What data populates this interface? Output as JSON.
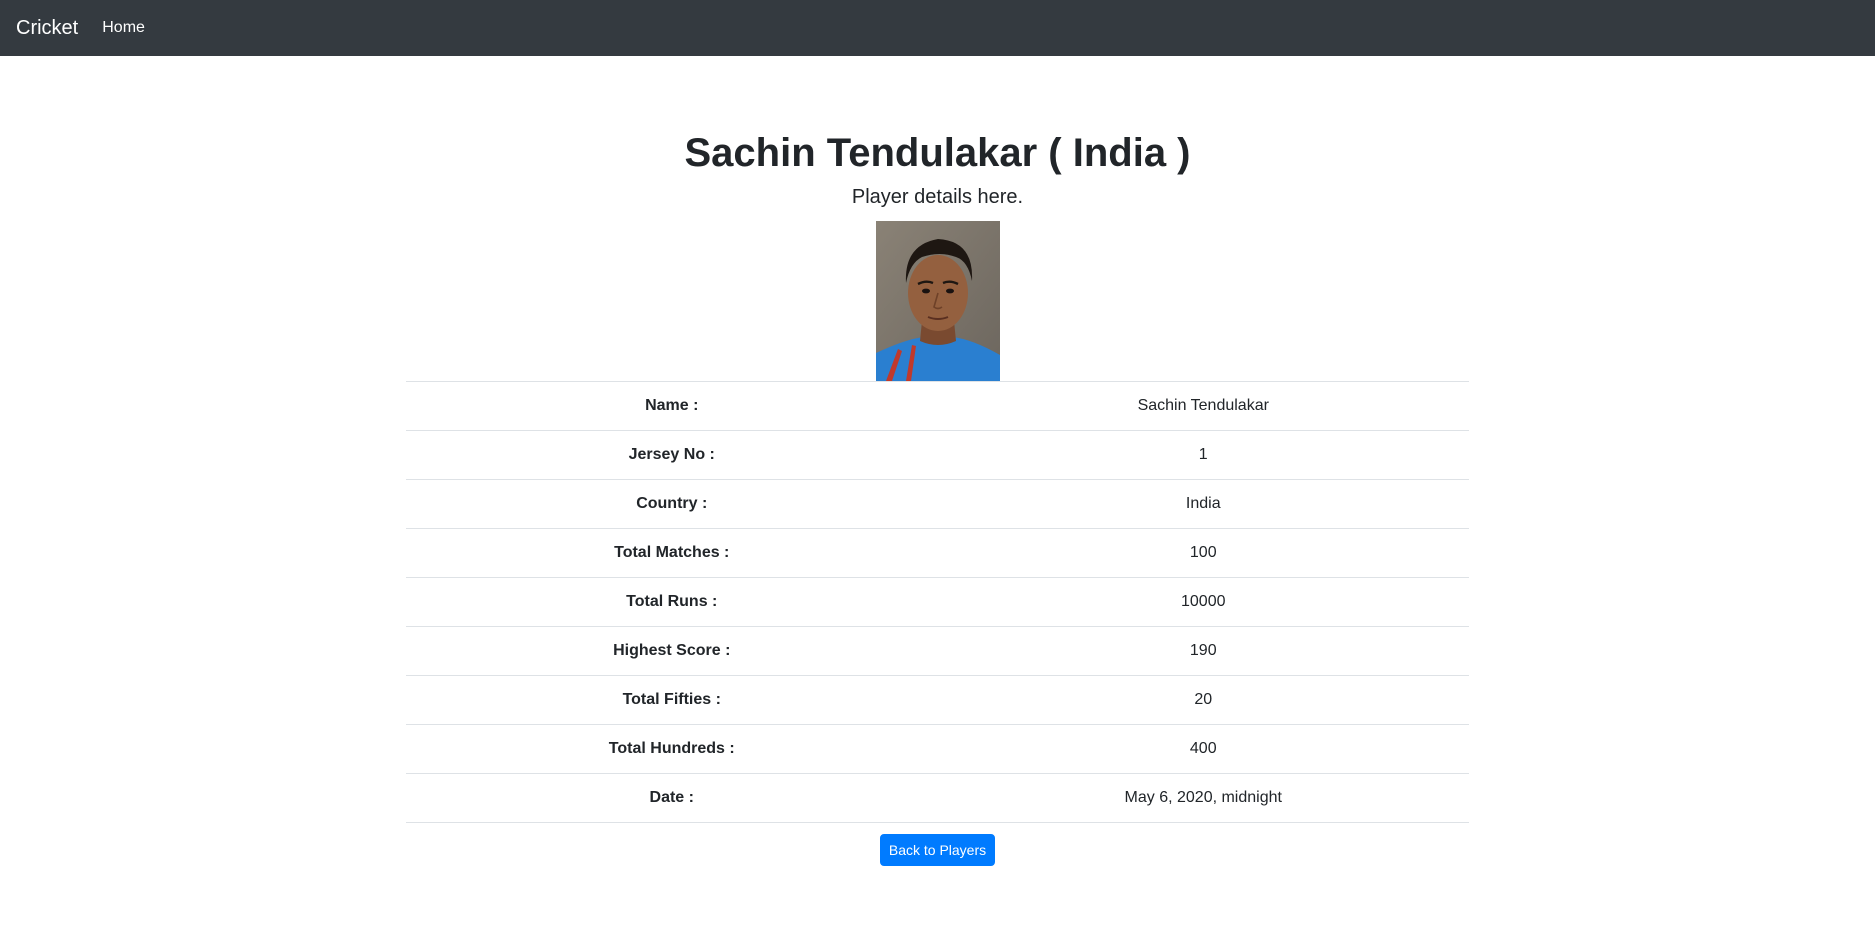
{
  "navbar": {
    "brand": "Cricket",
    "links": [
      {
        "label": "Home"
      }
    ]
  },
  "page": {
    "title": "Sachin Tendulakar ( India )",
    "lead": "Player details here."
  },
  "player": {
    "photo_alt": "Sachin Tendulakar",
    "details": [
      {
        "label": "Name :",
        "value": "Sachin Tendulakar"
      },
      {
        "label": "Jersey No :",
        "value": "1"
      },
      {
        "label": "Country :",
        "value": "India"
      },
      {
        "label": "Total Matches :",
        "value": "100"
      },
      {
        "label": "Total Runs :",
        "value": "10000"
      },
      {
        "label": "Highest Score :",
        "value": "190"
      },
      {
        "label": "Total Fifties :",
        "value": "20"
      },
      {
        "label": "Total Hundreds :",
        "value": "400"
      },
      {
        "label": "Date :",
        "value": "May 6, 2020, midnight"
      }
    ]
  },
  "actions": {
    "back_label": "Back to Players"
  },
  "colors": {
    "navbar_bg": "#343a40",
    "primary": "#007bff",
    "text": "#212529",
    "border": "#dee2e6"
  }
}
